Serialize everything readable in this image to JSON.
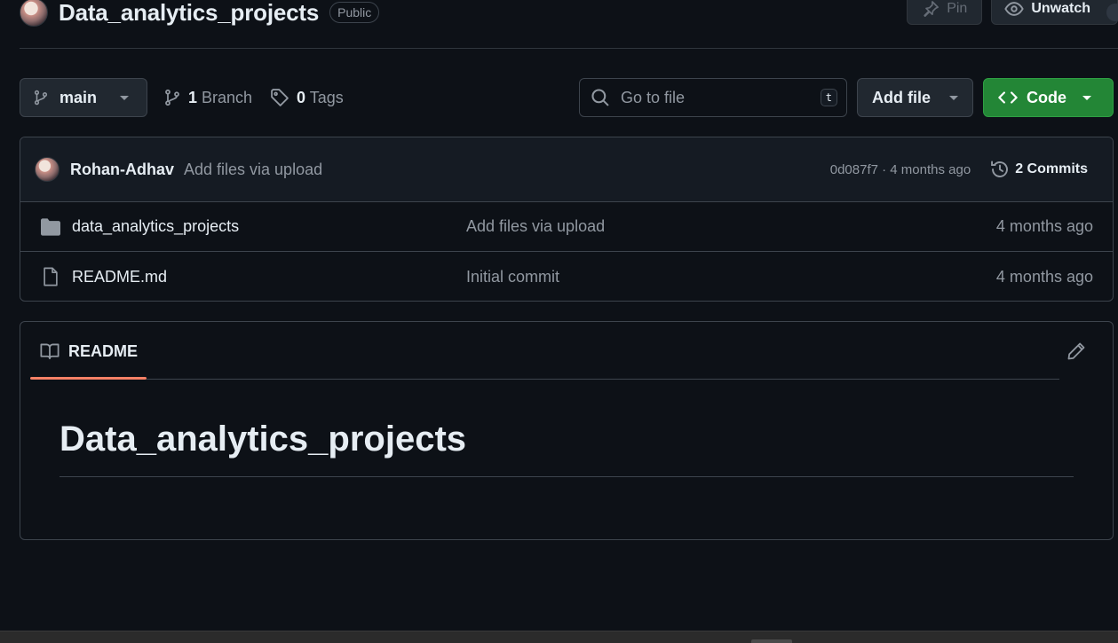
{
  "repo": {
    "name": "Data_analytics_projects",
    "visibility": "Public",
    "pin_label": "Pin",
    "unwatch_label": "Unwatch"
  },
  "toolbar": {
    "branch": "main",
    "branch_count": "1",
    "branch_label": "Branch",
    "tag_count": "0",
    "tag_label": "Tags",
    "search_placeholder": "Go to file",
    "search_shortcut": "t",
    "add_file_label": "Add file",
    "code_label": "Code"
  },
  "latest_commit": {
    "author": "Rohan-Adhav",
    "message": "Add files via upload",
    "meta": "0d087f7 · 4 months ago",
    "commits_label": "2 Commits"
  },
  "files": [
    {
      "type": "folder",
      "name": "data_analytics_projects",
      "commit": "Add files via upload",
      "age": "4 months ago"
    },
    {
      "type": "file",
      "name": "README.md",
      "commit": "Initial commit",
      "age": "4 months ago"
    }
  ],
  "readme": {
    "tab_label": "README",
    "heading": "Data_analytics_projects"
  },
  "colors": {
    "background": "#0d1117",
    "primary_button": "#238636",
    "tab_underline": "#f78166"
  },
  "icons": {
    "branch": "git-branch-icon",
    "tag": "tag-icon",
    "search": "search-icon",
    "code": "code-icon",
    "history": "history-icon",
    "folder": "folder-icon",
    "file": "file-icon",
    "book": "book-icon",
    "pencil": "pencil-icon",
    "pin": "pin-icon",
    "eye": "eye-icon"
  }
}
